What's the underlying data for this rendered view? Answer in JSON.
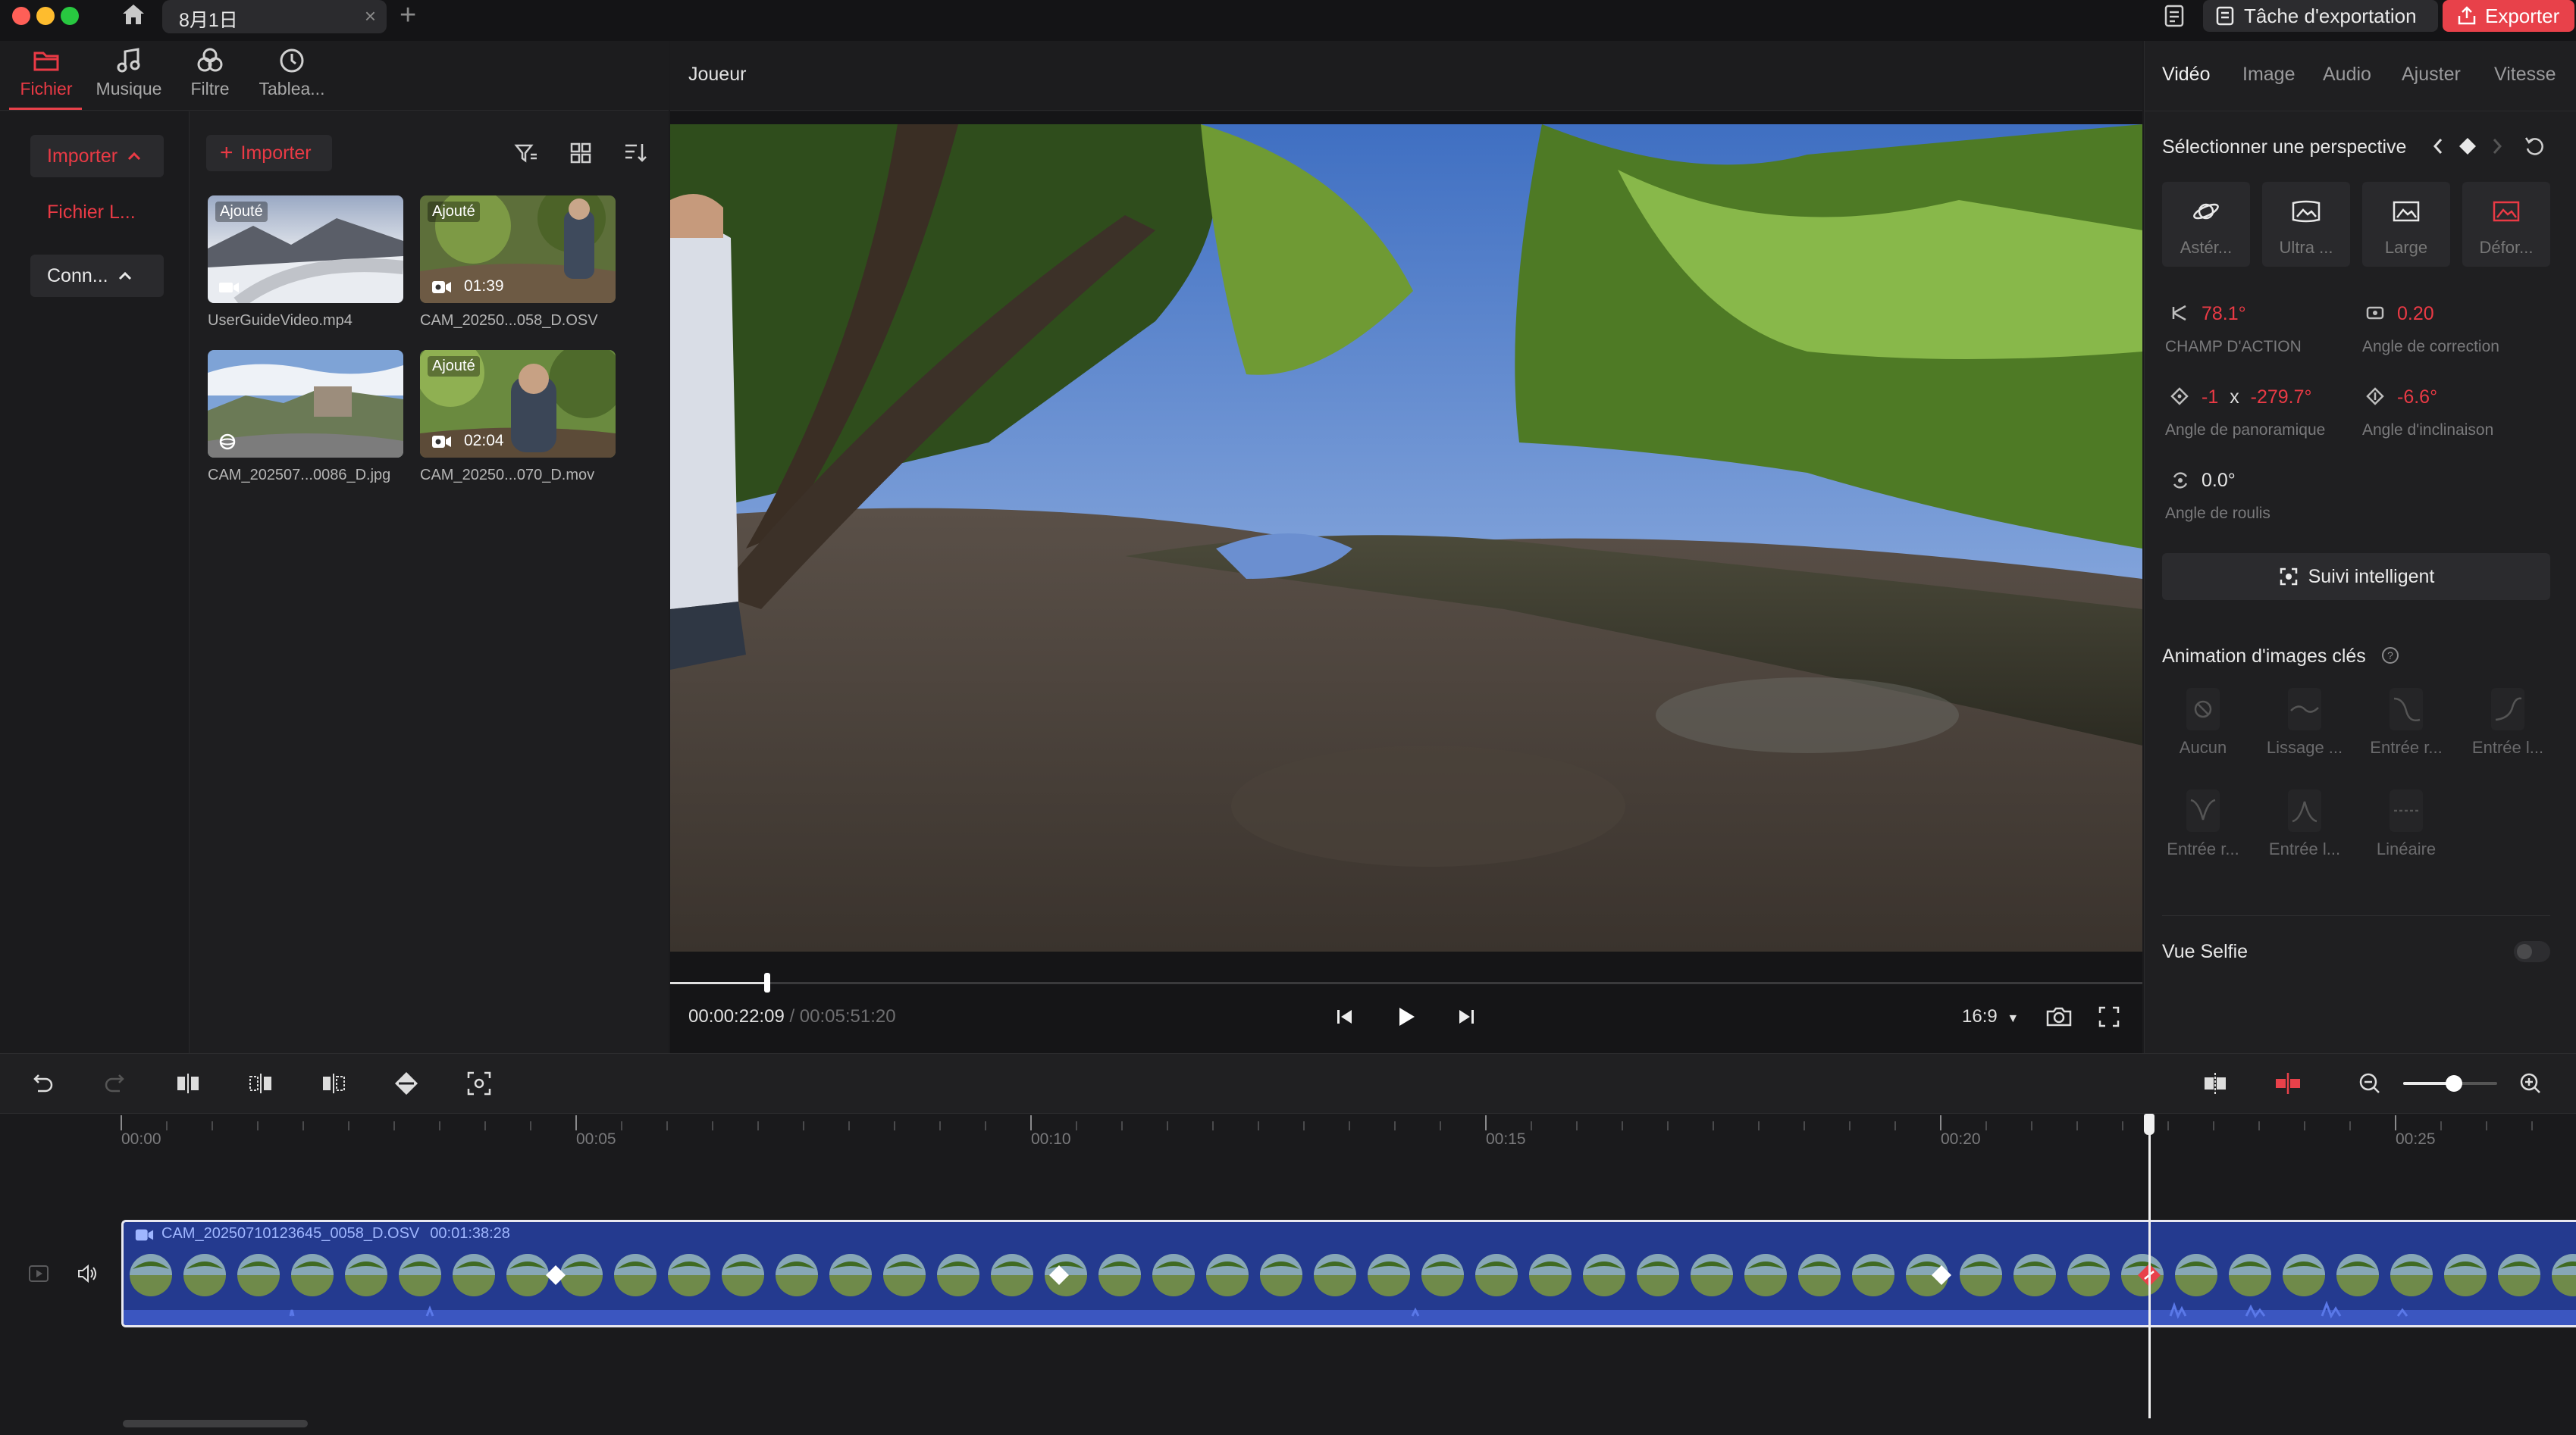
{
  "window": {
    "tab_title": "8月1日",
    "tab_close": "×",
    "tab_add": "+",
    "export_task_label": "Tâche d'exportation",
    "export_label": "Exporter",
    "colors": {
      "accent": "#e8414a",
      "clip": "#243a8f"
    }
  },
  "left_tabs": [
    {
      "label": "Fichier",
      "icon": "folder-icon",
      "active": true
    },
    {
      "label": "Musique",
      "icon": "music-note-icon"
    },
    {
      "label": "Filtre",
      "icon": "filter-circles-icon"
    },
    {
      "label": "Tablea...",
      "icon": "dial-icon"
    }
  ],
  "sidebar": {
    "import_label": "Importer",
    "local_files_label": "Fichier L...",
    "connect_label": "Conn..."
  },
  "media": {
    "import_label": "Importer",
    "items": [
      {
        "caption": "UserGuideVideo.mp4",
        "tag": "Ajouté",
        "duration": "",
        "kind": "video-icon"
      },
      {
        "caption": "CAM_20250...058_D.OSV",
        "tag": "Ajouté",
        "duration": "01:39",
        "kind": "360-video-icon"
      },
      {
        "caption": "CAM_202507...0086_D.jpg",
        "tag": "",
        "duration": "",
        "kind": "360-photo-icon"
      },
      {
        "caption": "CAM_20250...070_D.mov",
        "tag": "Ajouté",
        "duration": "02:04",
        "kind": "360-video-icon"
      }
    ]
  },
  "player": {
    "title": "Joueur",
    "current_time": "00:00:22:09",
    "total_time": "/ 00:05:51:20",
    "aspect": "16:9",
    "progress": 0.066
  },
  "right_tabs": [
    "Vidéo",
    "Image",
    "Audio",
    "Ajuster",
    "Vitesse"
  ],
  "perspective": {
    "label": "Sélectionner une perspective",
    "options": [
      {
        "label": "Astér...",
        "icon": "planet-icon"
      },
      {
        "label": "Ultra ...",
        "icon": "ultra-wide-icon"
      },
      {
        "label": "Large",
        "icon": "wide-icon"
      },
      {
        "label": "Défor...",
        "icon": "distort-icon"
      }
    ],
    "fov_value": "78.1°",
    "fov_label": "CHAMP D'ACTION",
    "correction_value": "0.20",
    "correction_label": "Angle de correction",
    "pan_value_a": "-1",
    "pan_x": "x",
    "pan_value_b": "-279.7°",
    "pan_label": "Angle de panoramique",
    "tilt_value": "-6.6°",
    "tilt_label": "Angle d'inclinaison",
    "roll_value": "0.0°",
    "roll_label": "Angle de roulis",
    "smart_track_label": "Suivi intelligent"
  },
  "keyframe_anim": {
    "label": "Animation d'images clés",
    "options": [
      "Aucun",
      "Lissage ...",
      "Entrée r...",
      "Entrée l...",
      "Entrée r...",
      "Entrée l...",
      "Linéaire"
    ]
  },
  "selfie": {
    "label": "Vue Selfie",
    "enabled": false
  },
  "timeline": {
    "ruler": [
      "00:00",
      "00:05",
      "00:10",
      "00:15",
      "00:20",
      "00:25"
    ],
    "clip_name": "CAM_20250710123645_0058_D.OSV",
    "clip_duration": "00:01:38:28"
  }
}
